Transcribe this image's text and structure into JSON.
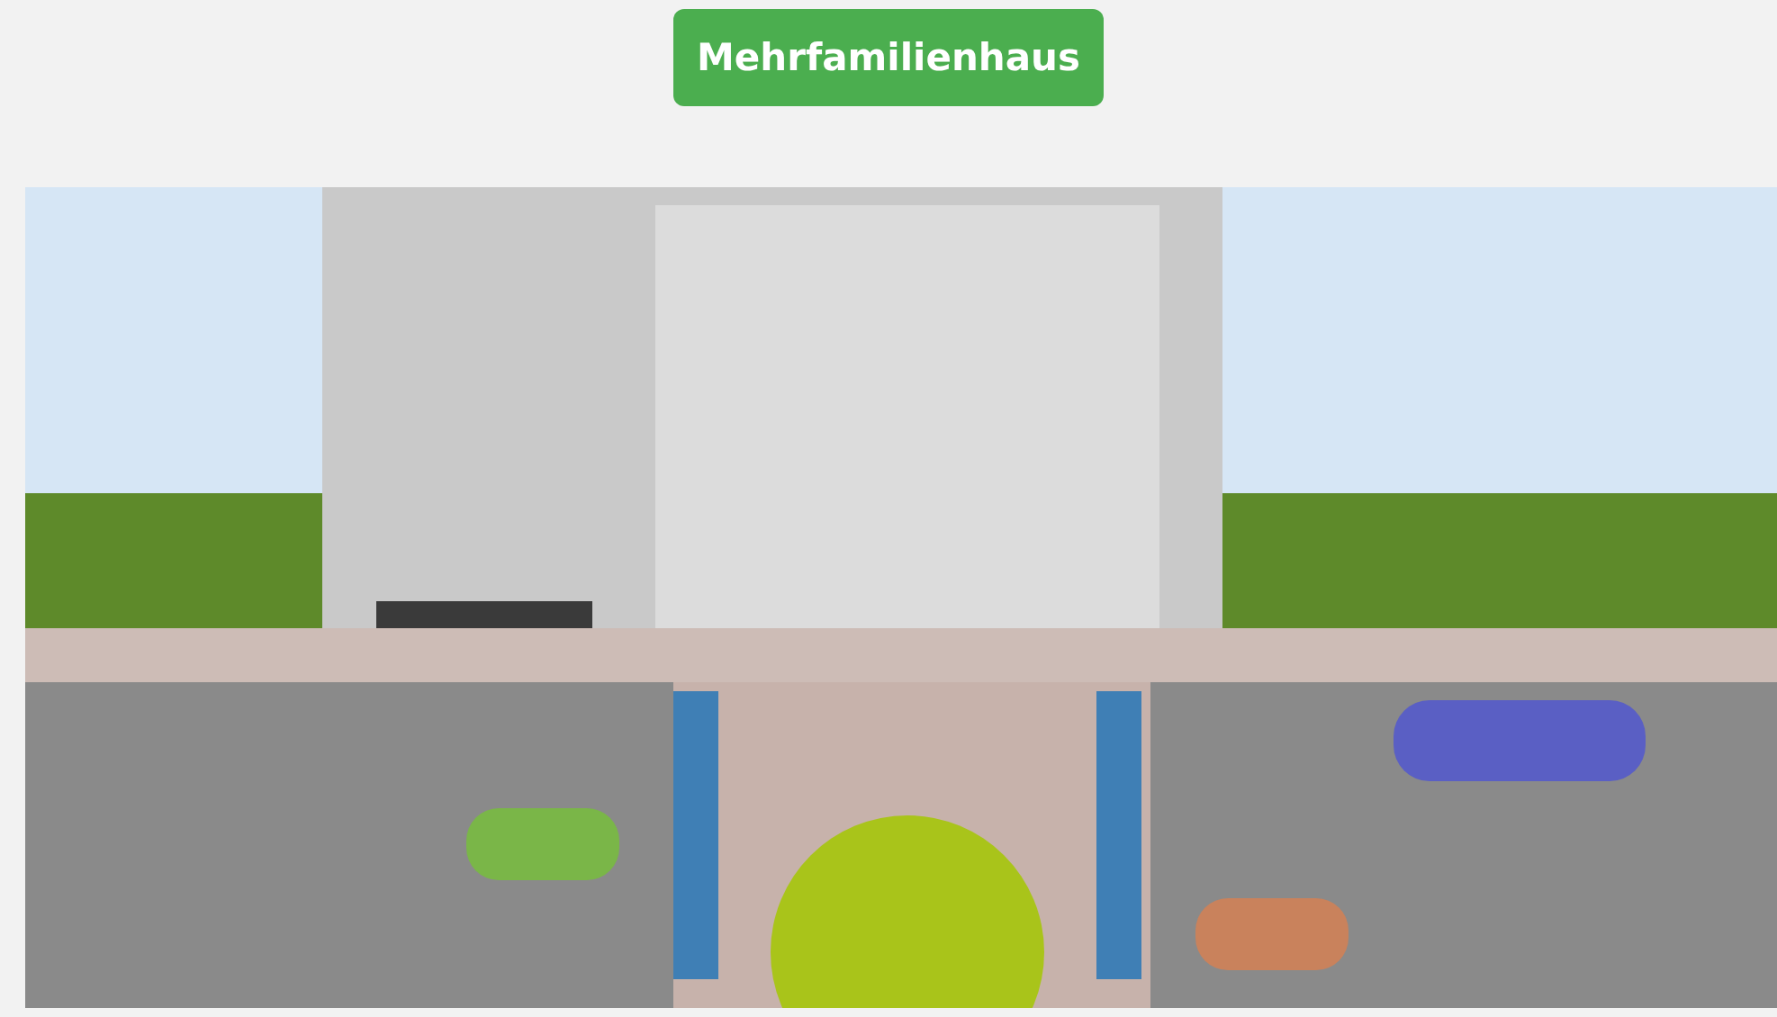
{
  "header": {
    "button": {
      "label": "Mehrfamilienhaus"
    }
  }
}
